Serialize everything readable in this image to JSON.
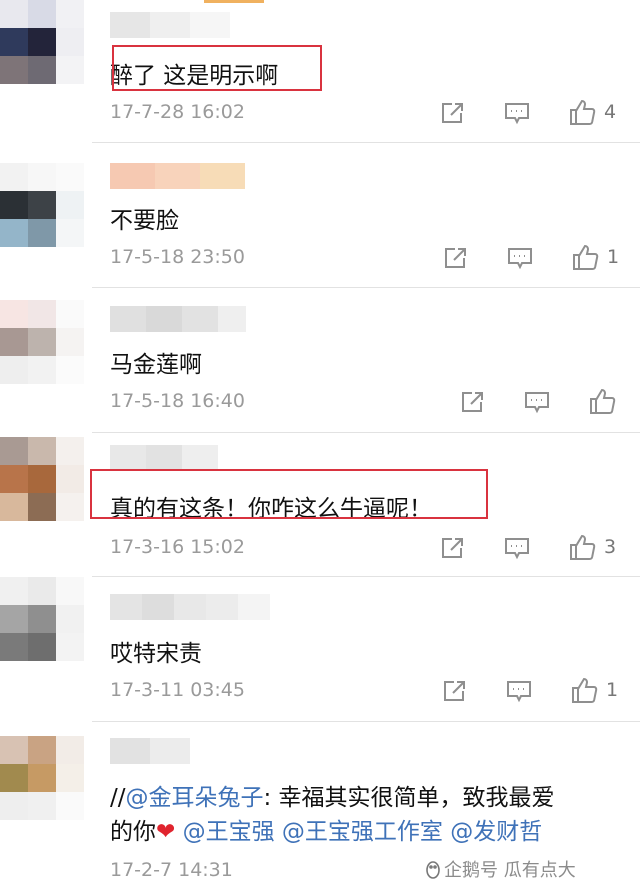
{
  "comments": [
    {
      "text": "醉了 这是明示啊",
      "time": "17-7-28 16:02",
      "likes": "4"
    },
    {
      "text": "不要脸",
      "time": "17-5-18 23:50",
      "likes": "1"
    },
    {
      "text": "马金莲啊",
      "time": "17-5-18 16:40",
      "likes": ""
    },
    {
      "text": "真的有这条！你咋这么牛逼呢！",
      "time": "17-3-16 15:02",
      "likes": "3"
    },
    {
      "text": "哎特宋责",
      "time": "17-3-11 03:45",
      "likes": "1"
    },
    {
      "line1_prefix": "//",
      "line1_mention": "@金耳朵兔子",
      "line1_rest": ": 幸福其实很简单，致我最爱",
      "line2_prefix": "的你",
      "line2_heart": "❤",
      "line2_mention1": "@王宝强",
      "line2_mention2": "@王宝强工作室",
      "line2_mention3": "@发财哲",
      "time": "17-2-7 14:31"
    }
  ],
  "watermark": "企鹅号 瓜有点大",
  "icons": [
    "share-icon",
    "comment-icon",
    "like-icon"
  ],
  "colors": {
    "highlight": "#d9333f",
    "mention": "#3f72b8",
    "time": "#9a9a9a"
  }
}
